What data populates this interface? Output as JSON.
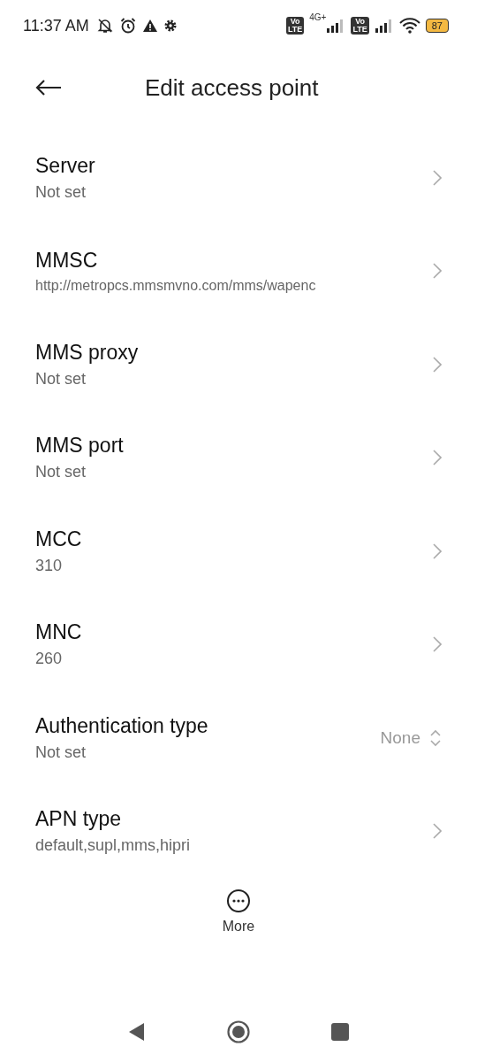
{
  "status_bar": {
    "time": "11:37 AM",
    "volte_badges": [
      [
        "Vo",
        "LTE"
      ],
      [
        "Vo",
        "LTE"
      ]
    ],
    "network": "4G+",
    "battery": "87"
  },
  "header": {
    "title": "Edit access point"
  },
  "settings": [
    {
      "kind": "link",
      "title": "Server",
      "value": "Not set"
    },
    {
      "kind": "link",
      "title": "MMSC",
      "value": "http://metropcs.mmsmvno.com/mms/wapenc"
    },
    {
      "kind": "link",
      "title": "MMS proxy",
      "value": "Not set"
    },
    {
      "kind": "link",
      "title": "MMS port",
      "value": "Not set"
    },
    {
      "kind": "link",
      "title": "MCC",
      "value": "310"
    },
    {
      "kind": "link",
      "title": "MNC",
      "value": "260"
    },
    {
      "kind": "select",
      "title": "Authentication type",
      "value": "Not set",
      "option": "None"
    },
    {
      "kind": "link",
      "title": "APN type",
      "value": "default,supl,mms,hipri"
    }
  ],
  "bottom_action": {
    "label": "More"
  }
}
